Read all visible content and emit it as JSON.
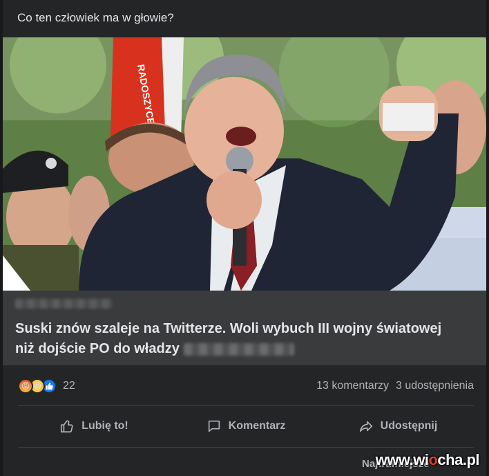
{
  "post": {
    "text": "Co ten człowiek ma w głowie?"
  },
  "link": {
    "title": "Suski znów szaleje na Twitterze. Woli wybuch III wojny światowej niż dojście PO do władzy",
    "info_icon": "info-icon",
    "info_label": "i"
  },
  "image": {
    "banner_text": "RADOSZYCE"
  },
  "stats": {
    "reactions": [
      "angry",
      "haha",
      "like"
    ],
    "reaction_count": "22",
    "comments": "13 komentarzy",
    "shares": "3 udostępnienia"
  },
  "actions": {
    "like": "Lubię to!",
    "comment": "Komentarz",
    "share": "Udostępnij"
  },
  "sort": {
    "label": "Najtrafniejsze"
  },
  "watermark": {
    "prefix": "www.wi",
    "accent": "o",
    "suffix": "cha.pl"
  },
  "colors": {
    "background": "#242526",
    "card": "#3a3b3c",
    "text_primary": "#e4e6eb",
    "text_secondary": "#b0b3b8",
    "like_blue": "#1877f2"
  }
}
